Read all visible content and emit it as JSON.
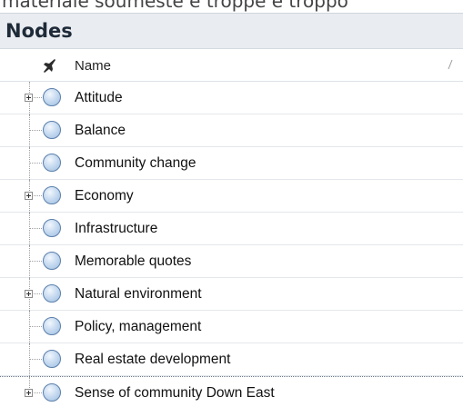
{
  "background_text": "materiale soumeste e troppe e troppo",
  "panel": {
    "title": "Nodes"
  },
  "columns": {
    "name_label": "Name"
  },
  "nodes": [
    {
      "label": "Attitude",
      "expandable": true
    },
    {
      "label": "Balance",
      "expandable": false
    },
    {
      "label": "Community change",
      "expandable": false
    },
    {
      "label": "Economy",
      "expandable": true
    },
    {
      "label": "Infrastructure",
      "expandable": false
    },
    {
      "label": "Memorable quotes",
      "expandable": false
    },
    {
      "label": "Natural environment",
      "expandable": true
    },
    {
      "label": "Policy, management",
      "expandable": false
    },
    {
      "label": "Real estate development",
      "expandable": false
    },
    {
      "label": "Sense of community Down East",
      "expandable": true,
      "selected": true
    }
  ],
  "colors": {
    "header_bg": "#e9ecf0",
    "node_icon": "#b8d0ec",
    "node_icon_border": "#5b7fab"
  }
}
